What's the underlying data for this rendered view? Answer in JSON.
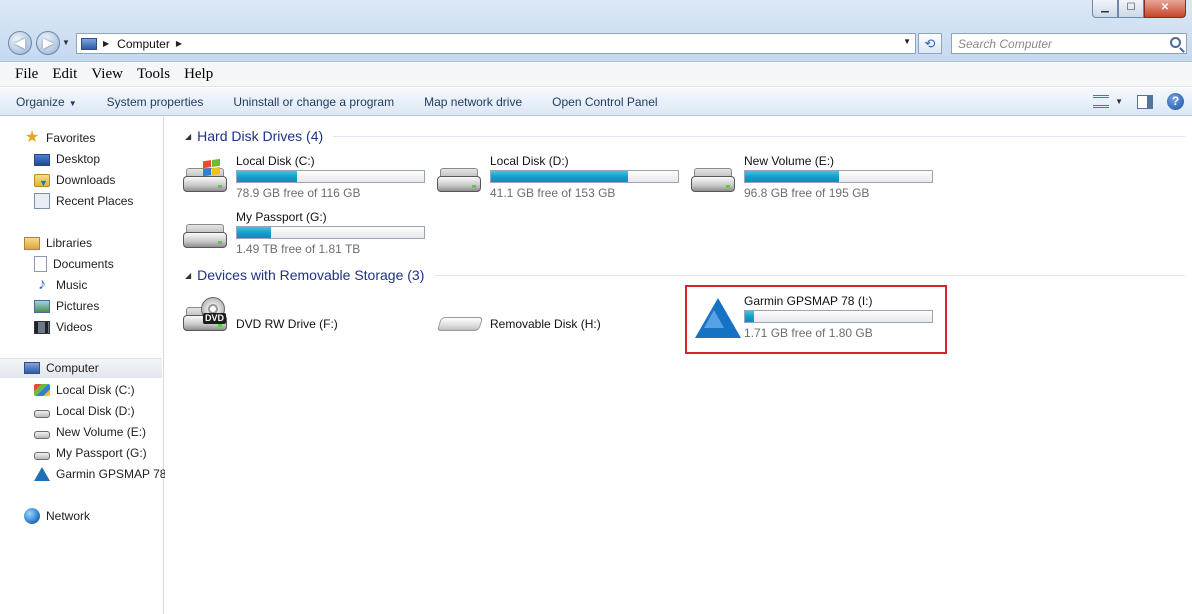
{
  "address": {
    "location": "Computer",
    "search_placeholder": "Search Computer"
  },
  "window_buttons": {
    "minimize": "▁",
    "maximize": "☐",
    "close": "✕"
  },
  "menu": [
    "File",
    "Edit",
    "View",
    "Tools",
    "Help"
  ],
  "command_bar": {
    "organize": "Organize",
    "items": [
      "System properties",
      "Uninstall or change a program",
      "Map network drive",
      "Open Control Panel"
    ]
  },
  "sidebar": {
    "favorites": {
      "label": "Favorites",
      "items": [
        "Desktop",
        "Downloads",
        "Recent Places"
      ]
    },
    "libraries": {
      "label": "Libraries",
      "items": [
        "Documents",
        "Music",
        "Pictures",
        "Videos"
      ]
    },
    "computer": {
      "label": "Computer",
      "items": [
        "Local Disk (C:)",
        "Local Disk (D:)",
        "New Volume (E:)",
        "My Passport (G:)",
        "Garmin GPSMAP 78"
      ]
    },
    "network": {
      "label": "Network"
    }
  },
  "groups": {
    "hdd": {
      "title": "Hard Disk Drives (4)"
    },
    "removable": {
      "title": "Devices with Removable Storage (3)"
    }
  },
  "drives": [
    {
      "name": "Local Disk (C:)",
      "free_text": "78.9 GB free of 116 GB",
      "used_fraction": 0.32
    },
    {
      "name": "Local Disk (D:)",
      "free_text": "41.1 GB free of 153 GB",
      "used_fraction": 0.73
    },
    {
      "name": "New Volume (E:)",
      "free_text": "96.8 GB free of 195 GB",
      "used_fraction": 0.5
    },
    {
      "name": "My Passport (G:)",
      "free_text": "1.49 TB free of 1.81 TB",
      "used_fraction": 0.18
    }
  ],
  "removable": [
    {
      "name": "DVD RW Drive (F:)"
    },
    {
      "name": "Removable Disk (H:)"
    },
    {
      "name": "Garmin GPSMAP 78 (I:)",
      "free_text": "1.71 GB free of 1.80 GB",
      "used_fraction": 0.05
    }
  ],
  "colors": {
    "highlight": "#d7232e",
    "group_title": "#1e3287",
    "bar_fill": "#16a0c9"
  }
}
